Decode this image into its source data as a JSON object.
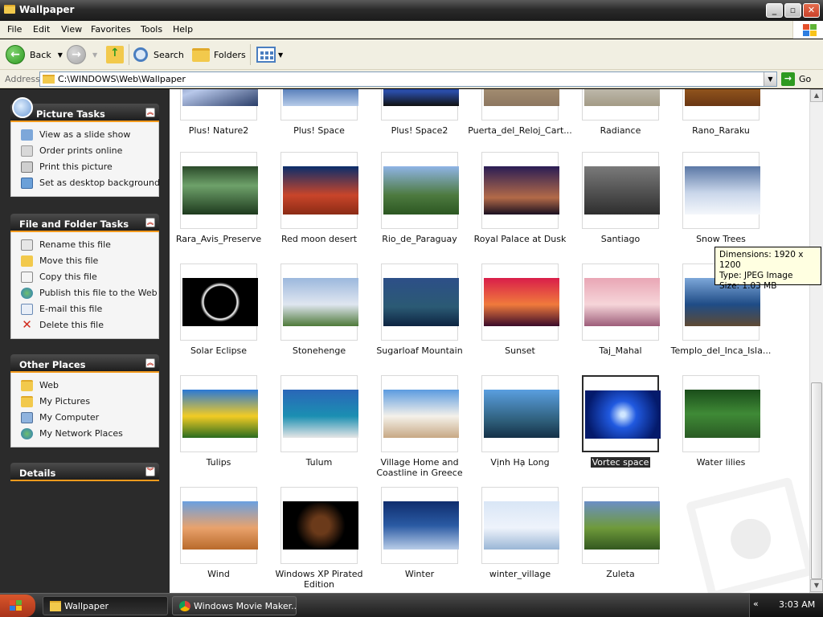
{
  "window": {
    "title": "Wallpaper"
  },
  "menu": [
    "File",
    "Edit",
    "View",
    "Favorites",
    "Tools",
    "Help"
  ],
  "toolbar": {
    "back": "Back",
    "search": "Search",
    "folders": "Folders"
  },
  "address": {
    "label": "Address",
    "value": "C:\\WINDOWS\\Web\\Wallpaper",
    "go": "Go"
  },
  "panels": {
    "picture_tasks": {
      "title": "Picture Tasks",
      "items": [
        "View as a slide show",
        "Order prints online",
        "Print this picture",
        "Set as desktop background"
      ]
    },
    "file_tasks": {
      "title": "File and Folder Tasks",
      "items": [
        "Rename this file",
        "Move this file",
        "Copy this file",
        "Publish this file to the Web",
        "E-mail this file",
        "Delete this file"
      ]
    },
    "other_places": {
      "title": "Other Places",
      "items": [
        "Web",
        "My Pictures",
        "My Computer",
        "My Network Places"
      ]
    },
    "details": {
      "title": "Details"
    }
  },
  "files": [
    "Plus! Nature2",
    "Plus! Space",
    "Plus! Space2",
    "Puerta_del_Reloj_Cart...",
    "Radiance",
    "Rano_Raraku",
    "Rara_Avis_Preserve",
    "Red moon desert",
    "Rio_de_Paraguay",
    "Royal Palace at Dusk",
    "Santiago",
    "Snow Trees",
    "Solar Eclipse",
    "Stonehenge",
    "Sugarloaf Mountain",
    "Sunset",
    "Taj_Mahal",
    "Templo_del_Inca_Isla...",
    "Tulips",
    "Tulum",
    "Village Home and Coastline in Greece",
    "Vịnh Hạ Long",
    "Vortec space",
    "Water lilies",
    "Wind",
    "Windows XP Pirated Edition",
    "Winter",
    "winter_village",
    "Zuleta"
  ],
  "selected_file": "Vortec space",
  "tooltip": {
    "line1": "Dimensions: 1920 x 1200",
    "line2": "Type: JPEG Image",
    "line3": "Size: 1.03 MB"
  },
  "taskbar": {
    "window1": "Wallpaper",
    "window2": "Windows Movie Maker...",
    "clock": "3:03 AM"
  }
}
